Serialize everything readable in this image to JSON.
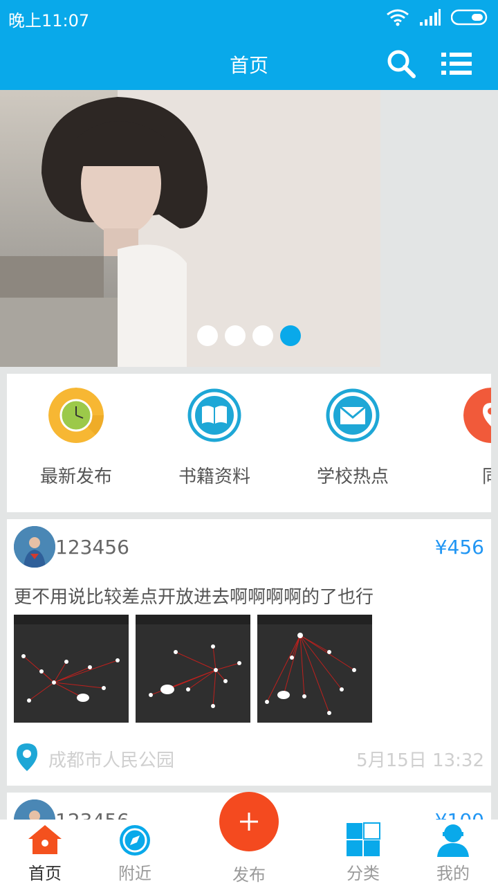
{
  "status_bar": {
    "time": "晚上11:07"
  },
  "header": {
    "title": "首页"
  },
  "banner": {
    "slides": 4,
    "active_slide": 4
  },
  "categories": [
    {
      "label": "最新发布",
      "icon": "clock-icon",
      "color": "#f7b733"
    },
    {
      "label": "书籍资料",
      "icon": "book-icon",
      "color": "#1ea7d6"
    },
    {
      "label": "学校热点",
      "icon": "mail-icon",
      "color": "#1ea7d6"
    },
    {
      "label": "同",
      "icon": "location-pin-icon",
      "color": "#f15a3a"
    }
  ],
  "posts": [
    {
      "username": "123456",
      "price": "¥456",
      "description": "更不用说比较差点开放进去啊啊啊啊的了也行",
      "location": "成都市人民公园",
      "date": "5月15日 13:32"
    },
    {
      "username": "123456",
      "price": "¥100"
    }
  ],
  "tabs": {
    "home": "首页",
    "nearby": "附近",
    "publish": "发布",
    "category": "分类",
    "mine": "我的"
  },
  "colors": {
    "primary": "#09a9ea",
    "accent": "#f44a1f",
    "price": "#2196f3"
  }
}
